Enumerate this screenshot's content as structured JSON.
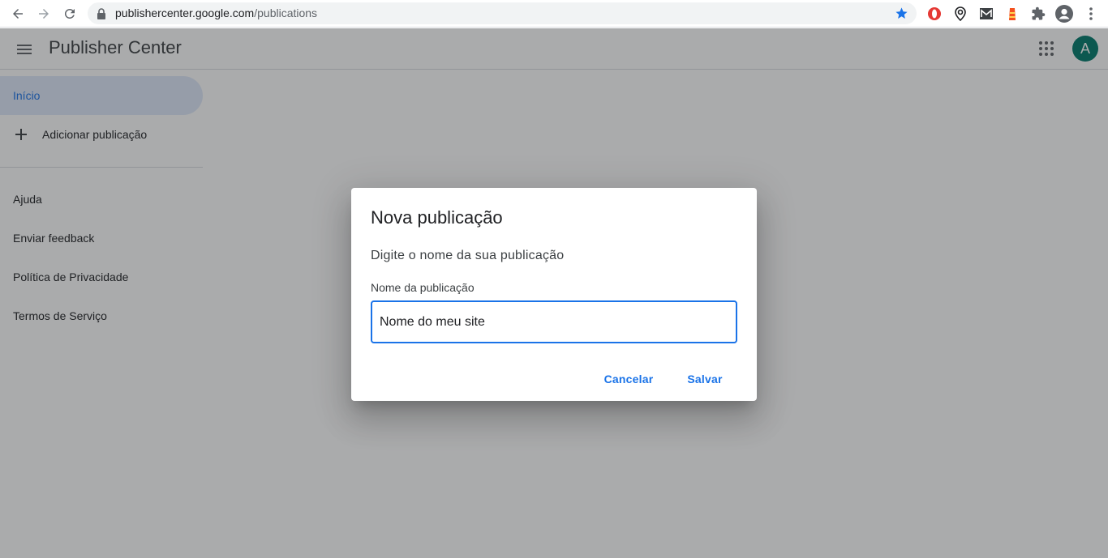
{
  "browser": {
    "url_host": "publishercenter.google.com",
    "url_path": "/publications"
  },
  "header": {
    "title": "Publisher Center",
    "avatar_letter": "A"
  },
  "sidebar": {
    "items": [
      {
        "label": "Início"
      },
      {
        "label": "Adicionar publicação"
      },
      {
        "label": "Ajuda"
      },
      {
        "label": "Enviar feedback"
      },
      {
        "label": "Política de Privacidade"
      },
      {
        "label": "Termos de Serviço"
      }
    ]
  },
  "dialog": {
    "title": "Nova publicação",
    "description": "Digite o nome da sua publicação",
    "field_label": "Nome da publicação",
    "field_value": "Nome do meu site",
    "cancel_label": "Cancelar",
    "save_label": "Salvar"
  },
  "colors": {
    "accent": "#1a73e8",
    "avatar": "#00796b",
    "scrim": "#202124"
  }
}
